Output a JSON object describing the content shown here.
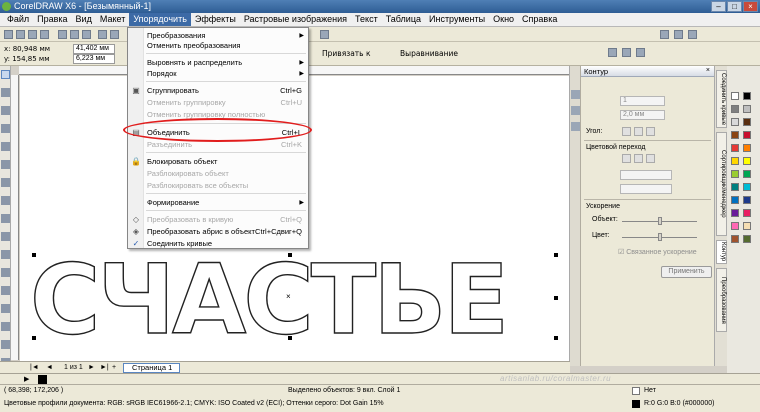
{
  "window": {
    "title": "CorelDRAW X6 - [Безымянный-1]"
  },
  "menubar": {
    "items": [
      "Файл",
      "Правка",
      "Вид",
      "Макет",
      "Упорядочить",
      "Эффекты",
      "Растровые изображения",
      "Текст",
      "Таблица",
      "Инструменты",
      "Окно",
      "Справка"
    ],
    "active": "Упорядочить"
  },
  "propertybar": {
    "x": "x: 80,948 мм",
    "y": "y: 154,85 мм",
    "w": "41,402 мм",
    "h": "6,223 мм",
    "snap": "Привязать к",
    "arrange": "Выравнивание"
  },
  "dropdown": {
    "items": [
      {
        "label": "Преобразования",
        "shortcut": "",
        "submenu": true,
        "disabled": false
      },
      {
        "label": "Отменить преобразования",
        "shortcut": "",
        "submenu": false,
        "disabled": false
      },
      {
        "label": "Выровнять и распределить",
        "shortcut": "",
        "submenu": true,
        "disabled": false
      },
      {
        "label": "Порядок",
        "shortcut": "",
        "submenu": true,
        "disabled": false
      },
      {
        "label": "Сгруппировать",
        "shortcut": "Ctrl+G",
        "submenu": false,
        "disabled": false
      },
      {
        "label": "Отменить группировку",
        "shortcut": "Ctrl+U",
        "submenu": false,
        "disabled": true
      },
      {
        "label": "Отменить группировку полностью",
        "shortcut": "",
        "submenu": false,
        "disabled": true
      },
      {
        "label": "Объединить",
        "shortcut": "Ctrl+L",
        "submenu": false,
        "disabled": false
      },
      {
        "label": "Разъединить",
        "shortcut": "Ctrl+K",
        "submenu": false,
        "disabled": true
      },
      {
        "label": "Блокировать объект",
        "shortcut": "",
        "submenu": false,
        "disabled": false
      },
      {
        "label": "Разблокировать объект",
        "shortcut": "",
        "submenu": false,
        "disabled": true
      },
      {
        "label": "Разблокировать все объекты",
        "shortcut": "",
        "submenu": false,
        "disabled": true
      },
      {
        "label": "Формирование",
        "shortcut": "",
        "submenu": true,
        "disabled": false
      },
      {
        "label": "Преобразовать в кривую",
        "shortcut": "Ctrl+Q",
        "submenu": false,
        "disabled": true
      },
      {
        "label": "Преобразовать абрис в объект",
        "shortcut": "Ctrl+Сдвиг+Q",
        "submenu": false,
        "disabled": false
      },
      {
        "label": "Соединить кривые",
        "shortcut": "",
        "submenu": false,
        "disabled": false
      }
    ]
  },
  "docker": {
    "title": "Контур",
    "width_value": "2,0 мм",
    "width_top": "1",
    "corner_label": "Угол:",
    "color_transition": "Цветовой переход",
    "acceleration": "Ускорение",
    "object_label": "Объект:",
    "color_label": "Цвет:",
    "linked_accel": "Связанное ускорение",
    "apply": "Применить"
  },
  "right_tabs": [
    "Соединить кривые",
    "Сортировщик/менеджер",
    "Контур",
    "Преобразования"
  ],
  "canvas": {
    "art_text": "СЧАСТЬЕ"
  },
  "pagebar": {
    "count": "1 из 1",
    "page_tab": "Страница 1"
  },
  "status": {
    "coords": "( 68,398; 172,206 )",
    "selection": "Выделено объектов: 9 вкл. Слой 1",
    "profiles": "Цветовые профили документа: RGB: sRGB IEC61966-2.1; CMYK: ISO Coated v2 (ECI); Оттенки серого: Dot Gain 15%",
    "fill": "Нет",
    "outline": "R:0 G:0 B:0 (#000000)",
    "watermark": "artisanlab.ru/coralmaster.ru"
  },
  "colors": {
    "palette": [
      "#ffffff",
      "#000000",
      "#7f7f7f",
      "#bfbfbf",
      "#d9d9d9",
      "#5a2e0e",
      "#8b4513",
      "#c8102e",
      "#e53935",
      "#ff7f00",
      "#ffd700",
      "#ffff00",
      "#9acd32",
      "#00a651",
      "#008080",
      "#00bcd4",
      "#0070c0",
      "#1e3a8a",
      "#6a1b9a",
      "#e91e63",
      "#ff69b4",
      "#f5deb3",
      "#a0522d",
      "#556b2f"
    ]
  }
}
